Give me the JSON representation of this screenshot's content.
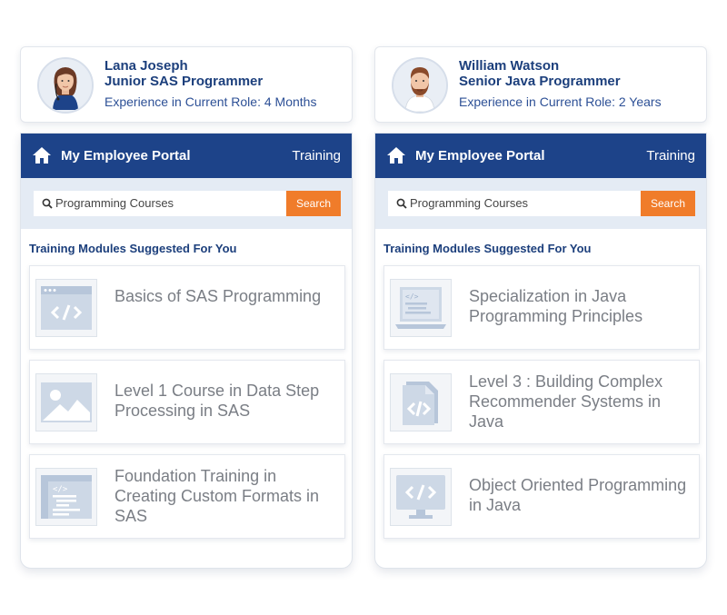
{
  "columns": [
    {
      "profile": {
        "name": "Lana Joseph",
        "role": "Junior SAS Programmer",
        "experience": "Experience in Current Role: 4 Months",
        "avatar_icon": "female-avatar-icon"
      },
      "header": {
        "title": "My Employee Portal",
        "tab": "Training",
        "home_icon": "home-icon"
      },
      "search": {
        "value": "Programming Courses",
        "button_label": "Search"
      },
      "suggested_title": "Training Modules Suggested For You",
      "modules": [
        {
          "icon": "browser-code-icon",
          "label": "Basics of SAS Programming"
        },
        {
          "icon": "image-icon",
          "label": "Level 1 Course in Data Step Processing in SAS"
        },
        {
          "icon": "code-window-icon",
          "label": "Foundation Training in Creating Custom Formats in SAS"
        }
      ]
    },
    {
      "profile": {
        "name": "William Watson",
        "role": "Senior Java Programmer",
        "experience": "Experience in Current Role: 2 Years",
        "avatar_icon": "male-avatar-icon"
      },
      "header": {
        "title": "My Employee Portal",
        "tab": "Training",
        "home_icon": "home-icon"
      },
      "search": {
        "value": "Programming Courses",
        "button_label": "Search"
      },
      "suggested_title": "Training Modules Suggested For You",
      "modules": [
        {
          "icon": "laptop-code-icon",
          "label": "Specialization in Java Programming Principles"
        },
        {
          "icon": "code-file-icon",
          "label": "Level 3 : Building Complex Recommender Systems in Java"
        },
        {
          "icon": "monitor-code-icon",
          "label": "Object Oriented Programming in Java"
        }
      ]
    }
  ],
  "colors": {
    "primary": "#1d4389",
    "accent": "#f07c2a",
    "search_bg": "#e4ebf4",
    "icon": "#c9d4e3"
  }
}
